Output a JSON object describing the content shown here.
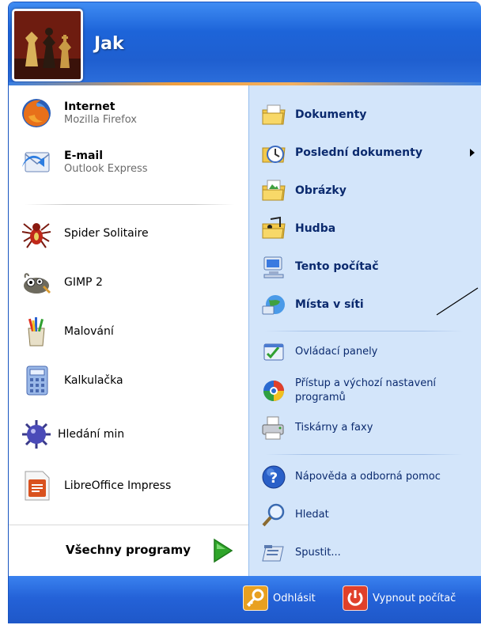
{
  "user": {
    "name": "Jak"
  },
  "pinned": [
    {
      "title": "Internet",
      "subtitle": "Mozilla Firefox",
      "icon": "firefox-icon"
    },
    {
      "title": "E-mail",
      "subtitle": "Outlook Express",
      "icon": "outlook-express-icon"
    }
  ],
  "recent_programs": [
    {
      "label": "Spider Solitaire",
      "icon": "spider-icon"
    },
    {
      "label": "GIMP 2",
      "icon": "gimp-icon"
    },
    {
      "label": "Malování",
      "icon": "paint-icon"
    },
    {
      "label": "Kalkulačka",
      "icon": "calculator-icon"
    },
    {
      "label": "Hledání min",
      "icon": "mine-icon"
    },
    {
      "label": "LibreOffice Impress",
      "icon": "impress-icon"
    }
  ],
  "all_programs": {
    "label": "Všechny programy"
  },
  "places": [
    {
      "label": "Dokumenty",
      "icon": "documents-folder-icon"
    },
    {
      "label": "Poslední dokumenty",
      "icon": "recent-documents-icon",
      "has_submenu": true
    },
    {
      "label": "Obrázky",
      "icon": "pictures-folder-icon"
    },
    {
      "label": "Hudba",
      "icon": "music-folder-icon"
    },
    {
      "label": "Tento počítač",
      "icon": "computer-icon"
    },
    {
      "label": "Místa v síti",
      "icon": "network-icon"
    }
  ],
  "settings": [
    {
      "label": "Ovládací panely",
      "icon": "control-panel-icon"
    },
    {
      "label": "Přístup a výchozí nastavení",
      "label2": "programů",
      "icon": "program-defaults-icon"
    },
    {
      "label": "Tiskárny a faxy",
      "icon": "printer-icon"
    }
  ],
  "support": [
    {
      "label": "Nápověda a odborná pomoc",
      "icon": "help-icon"
    },
    {
      "label": "Hledat",
      "icon": "search-icon"
    },
    {
      "label": "Spustit...",
      "icon": "run-icon"
    }
  ],
  "footer": {
    "logoff": "Odhlásit",
    "shutdown": "Vypnout počítač"
  },
  "colors": {
    "header_blue": "#1d64d9",
    "right_pane": "#d3e5fa",
    "right_text": "#0b2a6e",
    "all_programs_arrow": "#2fa52a"
  }
}
